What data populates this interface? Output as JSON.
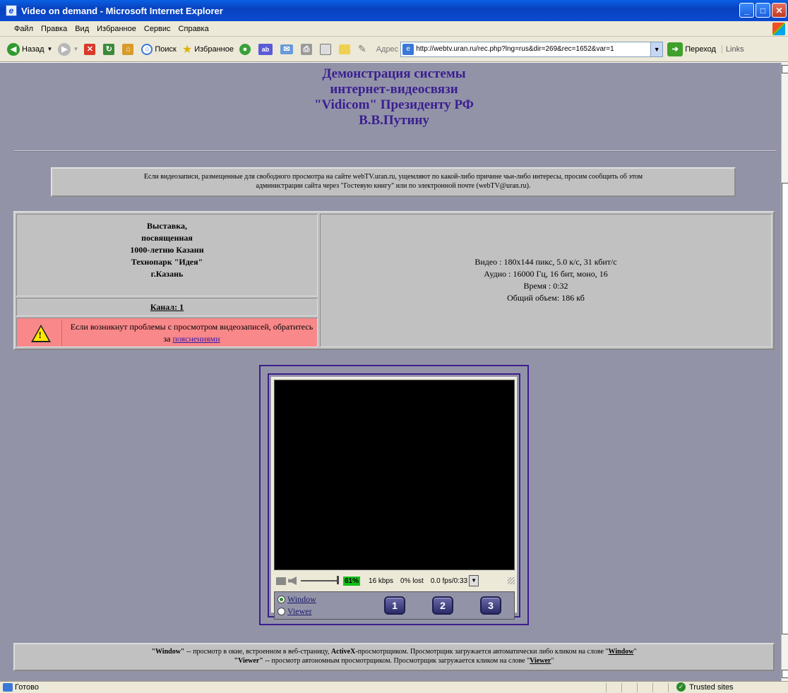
{
  "window": {
    "title": "Video on demand - Microsoft Internet Explorer",
    "btn_min": "_",
    "btn_max": "□",
    "btn_close": "✕"
  },
  "menu": [
    "Файл",
    "Правка",
    "Вид",
    "Избранное",
    "Сервис",
    "Справка"
  ],
  "toolbar": {
    "back": "Назад",
    "search": "Поиск",
    "favorites": "Избранное",
    "address_label": "Адрес",
    "url": "http://webtv.uran.ru/rec.php?lng=rus&dir=269&rec=1652&var=1",
    "go": "Переход",
    "links": "Links"
  },
  "page": {
    "heading": [
      "Демонстрация системы",
      "интернет-видеосвязи",
      "\"Vidicom\" Президенту РФ",
      "В.В.Путину"
    ],
    "notice": [
      "Если видеозаписи, размещенные для свободного просмотра на сайте webTV.uran.ru, ущемляют по какой-либо причине чьи-либо интересы, просим сообщить об этом",
      "администрации сайта через \"Гостевую книгу\" или по электронной почте (webTV@uran.ru)."
    ],
    "event": [
      "Выставка,",
      "посвященная",
      "1000-летию Казани",
      "Технопарк \"Идея\"",
      "г.Казань"
    ],
    "channel": "Канал: 1",
    "warning_text": "Если возникнут проблемы с просмотром видеозаписей, обратитесь за",
    "warning_link": "пояснениями",
    "media_info": [
      "Видео : 180x144 пикс, 5.0 к/с, 31 кбит/с",
      "Аудио : 16000 Гц, 16 бит, моно, 16",
      "Время : 0:32",
      "Общий объем: 186 кб"
    ]
  },
  "player": {
    "volume_percent": 61,
    "volume_label": "61%",
    "bitrate": "16 kbps",
    "lost": "0% lost",
    "fps_time": "0.0 fps/0:33",
    "mode_window": "Window",
    "mode_viewer": "Viewer",
    "mode_selected": "Window",
    "buttons": [
      "1",
      "2",
      "3"
    ]
  },
  "footer": {
    "line1_term": "\"Window\"",
    "line1_mid": " -- просмотр в окне, встроенном в веб-страницу, ",
    "line1_ax": "ActiveX",
    "line1_rest": "-просмотрщиком. Просмотрщик загружается автоматически либо кликом на слове \"",
    "line1_link": "Window",
    "line1_end": "\"",
    "line2_term": "\"Viewer\"",
    "line2_rest": " -- просмотр автономным просмотрщиком. Просмотрщик загружается кликом на слове \"",
    "line2_link": "Viewer",
    "line2_end": "\""
  },
  "status": {
    "left": "Готово",
    "zone": "Trusted sites"
  }
}
